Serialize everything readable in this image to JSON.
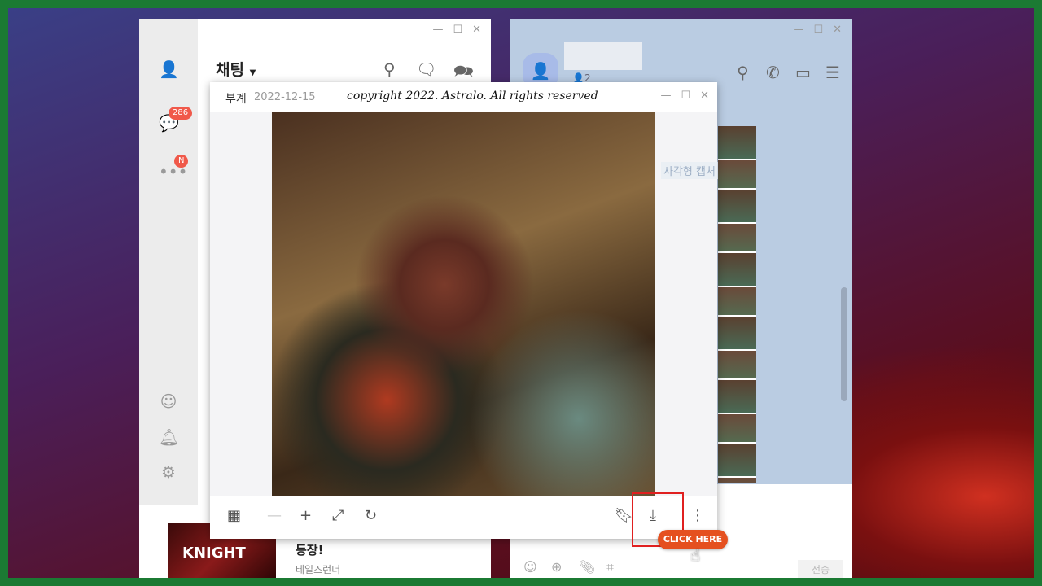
{
  "left_window": {
    "title": "채팅",
    "badges": {
      "chats": "286",
      "more": "N"
    }
  },
  "ad": {
    "thumb_text": "KNIGHT",
    "headline": "등장!",
    "source": "테일즈런너"
  },
  "right_window": {
    "member_count": "2",
    "faint_text": "사각형 캡처",
    "send_label": "전송"
  },
  "viewer": {
    "sender": "부계",
    "date": "2022-12-15",
    "copyright": "copyright 2022. Astralo. All rights reserved"
  },
  "overlay": {
    "click_label": "CLICK HERE"
  },
  "colors": {
    "frame": "#1b7a33",
    "highlight": "#e02020",
    "callout": "#e5501f",
    "badge": "#f0594a"
  }
}
